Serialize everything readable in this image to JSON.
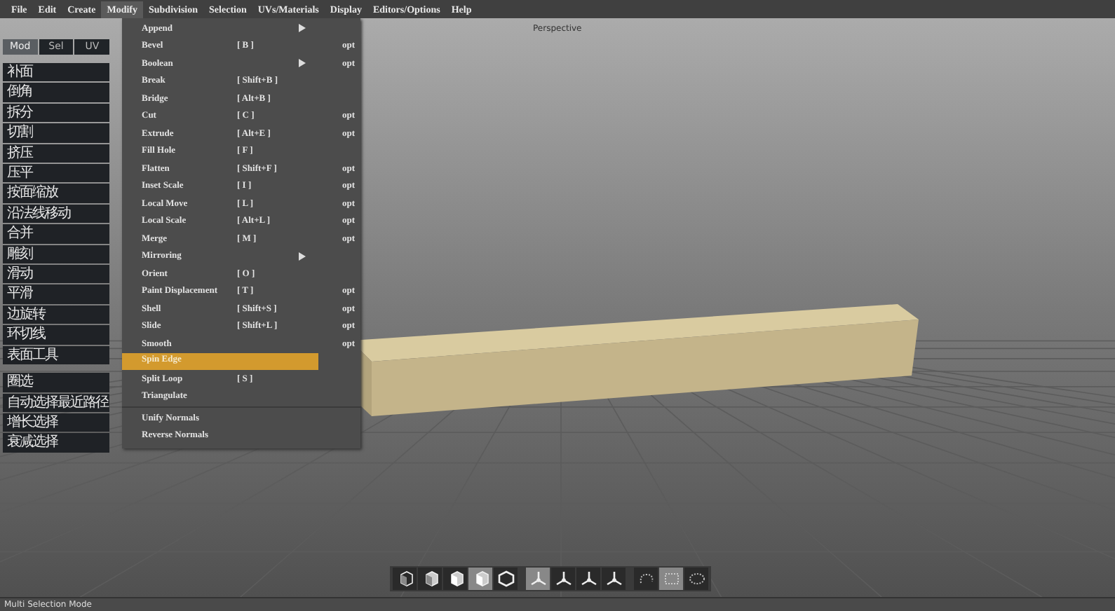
{
  "menu_bar": [
    {
      "label": "File",
      "selected": false
    },
    {
      "label": "Edit",
      "selected": false
    },
    {
      "label": "Create",
      "selected": false
    },
    {
      "label": "Modify",
      "selected": true
    },
    {
      "label": "Subdivision",
      "selected": false
    },
    {
      "label": "Selection",
      "selected": false
    },
    {
      "label": "UVs/Materials",
      "selected": false
    },
    {
      "label": "Display",
      "selected": false
    },
    {
      "label": "Editors/Options",
      "selected": false
    },
    {
      "label": "Help",
      "selected": false
    }
  ],
  "modify_menu": {
    "items": [
      {
        "kind": "item",
        "label": "Append",
        "submenu": true,
        "selected": false
      },
      {
        "kind": "item",
        "label": "Bevel",
        "shortcut": "[ B ]",
        "option": "opt",
        "selected": false
      },
      {
        "kind": "item",
        "label": "Boolean",
        "submenu": true,
        "option": "opt",
        "selected": false
      },
      {
        "kind": "item",
        "label": "Break",
        "shortcut": "[ Shift+B ]",
        "selected": false
      },
      {
        "kind": "item",
        "label": "Bridge",
        "shortcut": "[ Alt+B ]",
        "selected": false
      },
      {
        "kind": "item",
        "label": "Cut",
        "shortcut": "[ C ]",
        "option": "opt",
        "selected": false
      },
      {
        "kind": "item",
        "label": "Extrude",
        "shortcut": "[ Alt+E ]",
        "option": "opt",
        "selected": false
      },
      {
        "kind": "item",
        "label": "Fill Hole",
        "shortcut": "[ F ]",
        "selected": false
      },
      {
        "kind": "item",
        "label": "Flatten",
        "shortcut": "[ Shift+F ]",
        "option": "opt",
        "selected": false
      },
      {
        "kind": "item",
        "label": "Inset Scale",
        "shortcut": "[ I ]",
        "option": "opt",
        "selected": false
      },
      {
        "kind": "item",
        "label": "Local Move",
        "shortcut": "[ L ]",
        "option": "opt",
        "selected": false
      },
      {
        "kind": "item",
        "label": "Local Scale",
        "shortcut": "[ Alt+L ]",
        "option": "opt",
        "selected": false
      },
      {
        "kind": "item",
        "label": "Merge",
        "shortcut": "[ M ]",
        "option": "opt",
        "selected": false
      },
      {
        "kind": "item",
        "label": "Mirroring",
        "submenu": true,
        "selected": false
      },
      {
        "kind": "item",
        "label": "Orient",
        "shortcut": "[ O ]",
        "selected": false
      },
      {
        "kind": "item",
        "label": "Paint Displacement",
        "shortcut": "[ T ]",
        "option": "opt",
        "selected": false
      },
      {
        "kind": "item",
        "label": "Shell",
        "shortcut": "[ Shift+S ]",
        "option": "opt",
        "selected": false
      },
      {
        "kind": "item",
        "label": "Slide",
        "shortcut": "[ Shift+L ]",
        "option": "opt",
        "selected": false
      },
      {
        "kind": "item",
        "label": "Smooth",
        "option": "opt",
        "selected": false
      },
      {
        "kind": "item",
        "label": "Spin Edge",
        "selected": true
      },
      {
        "kind": "item",
        "label": "Split Loop",
        "shortcut": "[ S ]",
        "selected": false
      },
      {
        "kind": "item",
        "label": "Triangulate",
        "selected": false
      },
      {
        "kind": "separator"
      },
      {
        "kind": "item",
        "label": "Unify Normals",
        "selected": false
      },
      {
        "kind": "item",
        "label": "Reverse Normals",
        "selected": false
      }
    ]
  },
  "sidebar": {
    "tabs": [
      {
        "label": "Mod",
        "selected": true
      },
      {
        "label": "Sel",
        "selected": false
      },
      {
        "label": "UV",
        "selected": false
      }
    ],
    "groups": [
      [
        "补面",
        "倒角",
        "拆分",
        "切割",
        "挤压",
        "压平",
        "按面缩放",
        "沿法线移动",
        "合并",
        "雕刻",
        "滑动",
        "平滑",
        "边旋转",
        "环切线",
        "表面工具"
      ],
      [
        "圈选",
        "自动选择最近路径",
        "增长选择",
        "衰减选择"
      ]
    ]
  },
  "viewport": {
    "title": "Perspective"
  },
  "toolbar": {
    "groups": [
      [
        {
          "kind": "vertex",
          "selected": false
        },
        {
          "kind": "edge",
          "selected": false
        },
        {
          "kind": "face",
          "selected": false
        },
        {
          "kind": "object",
          "selected": true
        },
        {
          "kind": "hex",
          "selected": false
        }
      ],
      [
        {
          "kind": "axis",
          "selected": true
        },
        {
          "kind": "axis",
          "selected": false
        },
        {
          "kind": "axis",
          "selected": false
        },
        {
          "kind": "axis",
          "selected": false
        }
      ],
      [
        {
          "kind": "lasso",
          "selected": false
        },
        {
          "kind": "rect",
          "selected": true
        },
        {
          "kind": "paint",
          "selected": false
        }
      ]
    ]
  },
  "status_bar": {
    "text": "Multi Selection Mode"
  }
}
